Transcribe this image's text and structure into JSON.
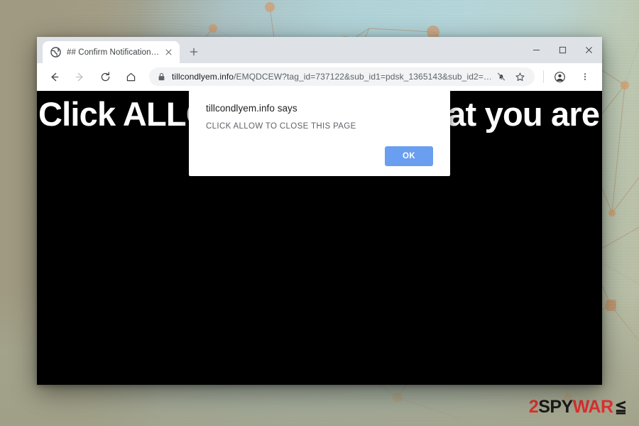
{
  "desktop": {
    "watermark": {
      "part1": "2",
      "part2": "SPY",
      "part3": "WAR",
      "part4": "≦",
      "red": "#e03030",
      "black": "#1a1a1a"
    }
  },
  "browser": {
    "tab": {
      "favicon": "globe-icon",
      "title": "## Confirm Notifications ##",
      "close_label": "×"
    },
    "new_tab_label": "+",
    "window_controls": {
      "minimize": "—",
      "maximize": "□",
      "close": "×"
    },
    "toolbar": {
      "back": "back-arrow-icon",
      "forward": "forward-arrow-icon",
      "reload": "reload-icon",
      "home": "home-icon",
      "lock": "lock-icon",
      "url_host": "tillcondlyem.info",
      "url_path": "/EMQDCEW?tag_id=737122&sub_id1=pdsk_1365143&sub_id2=…",
      "notifications_blocked": "bell-slash-icon",
      "bookmark": "star-icon",
      "profile": "profile-avatar-icon",
      "menu": "three-dot-menu-icon"
    }
  },
  "page": {
    "headline": "Click ALLOW to confirm that you are",
    "background": "#000000",
    "text_color": "#ffffff"
  },
  "dialog": {
    "title": "tillcondlyem.info says",
    "message": "CLICK ALLOW TO CLOSE THIS PAGE",
    "ok_label": "OK",
    "ok_color": "#6a9ef0"
  }
}
